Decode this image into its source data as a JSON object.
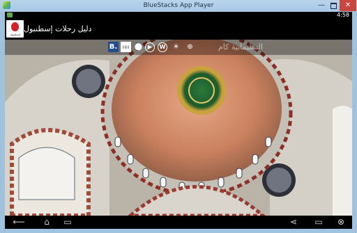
{
  "window": {
    "title": "BlueStacks App Player",
    "minimize_glyph": "—",
    "close_glyph": "✕"
  },
  "statusbar": {
    "time": "4:58"
  },
  "app": {
    "title": "دليل رحلات إسطنبول",
    "logo_caption": "إسطنبول"
  },
  "toolbar": {
    "icons": [
      "booking-icon",
      "barcode-icon",
      "map-pin-icon",
      "play-icon",
      "wikipedia-icon",
      "weather-icon",
      "globe-icon"
    ],
    "booking_label": "B.",
    "wiki_label": "W"
  },
  "photo": {
    "caption": "السليمانية كام"
  },
  "navbar": {
    "back_glyph": "⟵",
    "home_glyph": "⌂",
    "recents_glyph": "▭",
    "share_glyph": "⋖",
    "rotate_glyph": "▭",
    "close_glyph": "⊗"
  },
  "colors": {
    "chrome": "#a8c8e6",
    "close_button": "#c8463d",
    "booking_blue": "#1f4d8e",
    "logo_red": "#d3202a"
  }
}
